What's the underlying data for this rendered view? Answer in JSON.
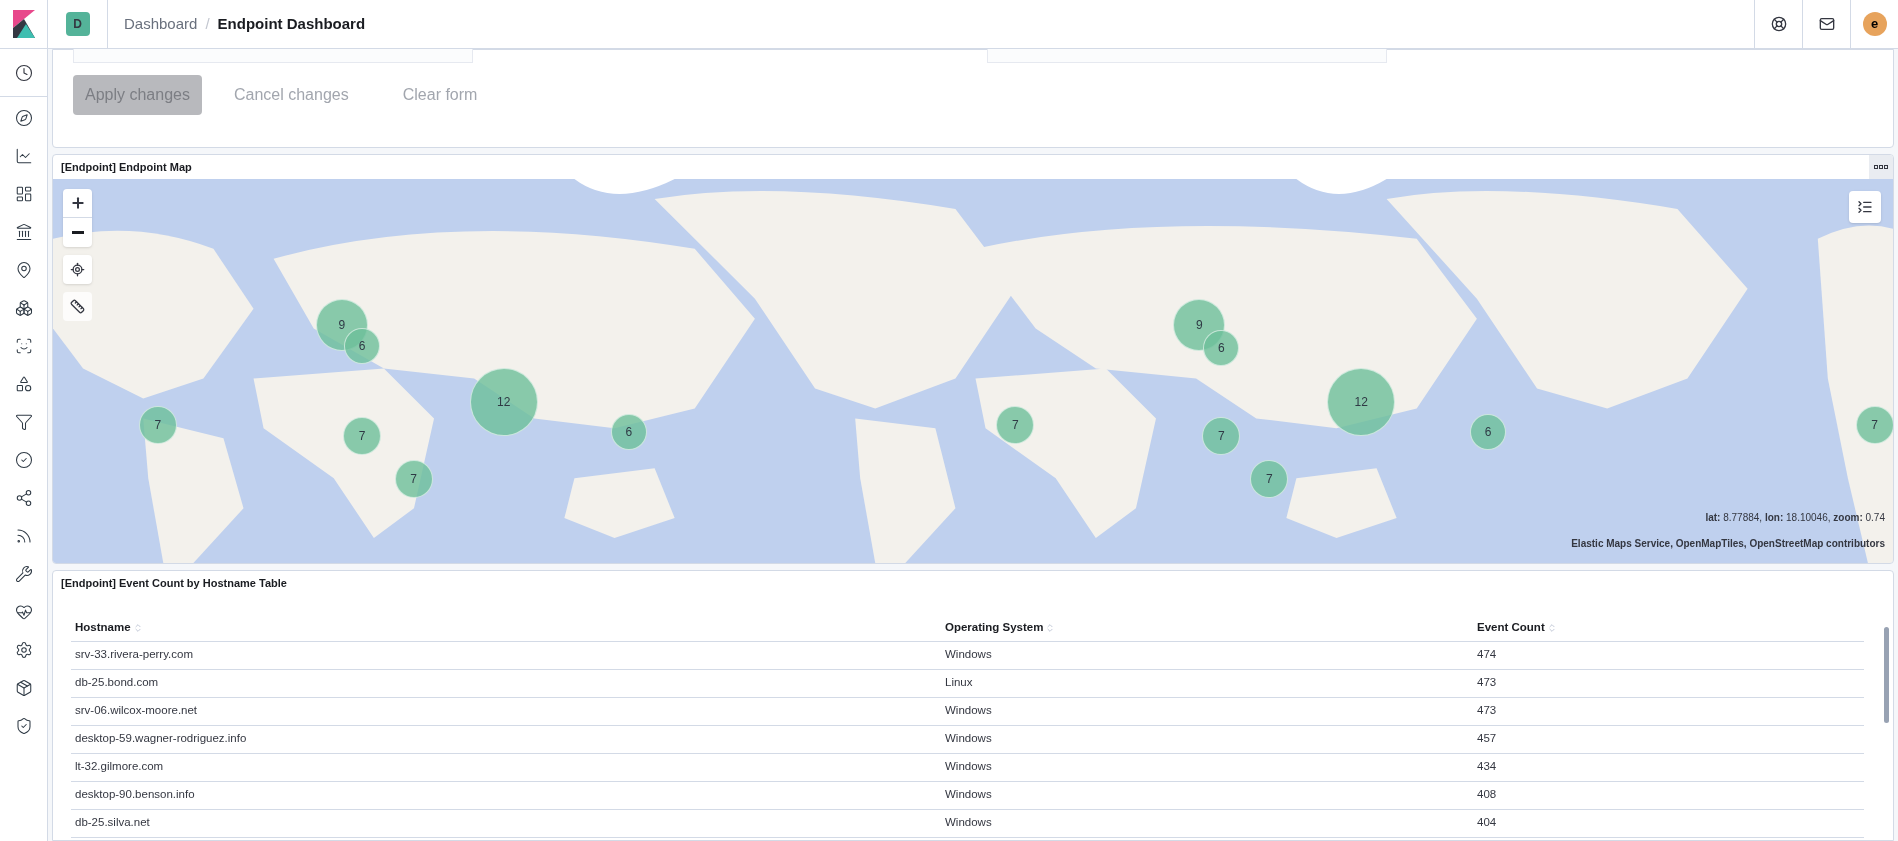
{
  "header": {
    "space_initial": "D",
    "breadcrumb_separator": "/",
    "breadcrumbs": [
      {
        "label": "Dashboard",
        "selected": false
      },
      {
        "label": "Endpoint Dashboard",
        "selected": true
      }
    ],
    "avatar_initial": "e"
  },
  "form": {
    "buttons": [
      {
        "label": "Apply changes",
        "kind": "filled",
        "disabled": true
      },
      {
        "label": "Cancel changes",
        "kind": "empty",
        "disabled": true
      },
      {
        "label": "Clear form",
        "kind": "empty",
        "disabled": true
      }
    ]
  },
  "map_panel": {
    "title": "[Endpoint] Endpoint Map",
    "coordinates": "**lat:** 8.77884, **lon:** 18.10046, **zoom:** 0.74",
    "attribution": "Elastic Maps Service, OpenMapTiles, OpenStreetMap contributors",
    "clusters": [
      "9",
      "6",
      "12",
      "7",
      "7",
      "7",
      "6",
      "7",
      "9",
      "6",
      "12",
      "7",
      "7",
      "6",
      "7"
    ]
  },
  "table_panel": {
    "title": "[Endpoint] Event Count by Hostname Table",
    "columns": [
      "Hostname",
      "Operating System",
      "Event Count"
    ],
    "rows": [
      [
        "srv-33.rivera-perry.com",
        "Windows",
        "474"
      ],
      [
        "db-25.bond.com",
        "Linux",
        "473"
      ],
      [
        "srv-06.wilcox-moore.net",
        "Windows",
        "473"
      ],
      [
        "desktop-59.wagner-rodriguez.info",
        "Windows",
        "457"
      ],
      [
        "lt-32.gilmore.com",
        "Windows",
        "434"
      ],
      [
        "desktop-90.benson.info",
        "Windows",
        "408"
      ],
      [
        "db-25.silva.net",
        "Windows",
        "404"
      ]
    ]
  }
}
